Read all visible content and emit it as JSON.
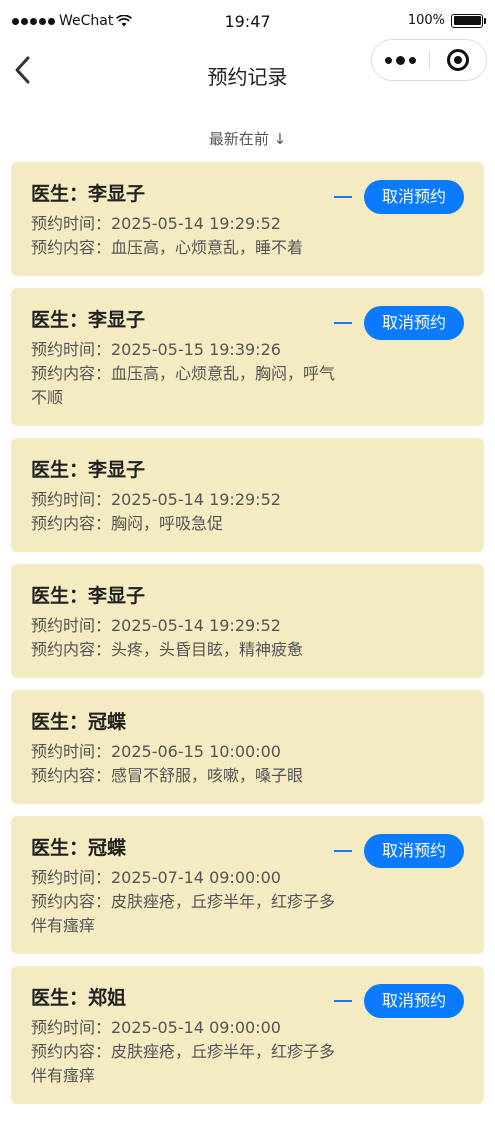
{
  "status_bar": {
    "carrier": "WeChat",
    "time": "19:47",
    "battery": "100%"
  },
  "nav": {
    "title": "预约记录"
  },
  "sort_label": "最新在前 ↓",
  "cancel_label": "取消预约",
  "records": [
    {
      "doctor": "医生：李显子",
      "time": "预约时间：2025-05-14 19:29:52",
      "content": "预约内容：血压高，心烦意乱，睡不着",
      "cancellable": true
    },
    {
      "doctor": "医生：李显子",
      "time": "预约时间：2025-05-15 19:39:26",
      "content": "预约内容：血压高，心烦意乱，胸闷，呼气不顺",
      "cancellable": true
    },
    {
      "doctor": "医生：李显子",
      "time": "预约时间：2025-05-14 19:29:52",
      "content": "预约内容：胸闷，呼吸急促",
      "cancellable": false
    },
    {
      "doctor": "医生：李显子",
      "time": "预约时间：2025-05-14 19:29:52",
      "content": "预约内容：头疼，头昏目眩，精神疲惫",
      "cancellable": false
    },
    {
      "doctor": "医生：冠蝶",
      "time": "预约时间：2025-06-15 10:00:00",
      "content": "预约内容：感冒不舒服，咳嗽，嗓子眼",
      "cancellable": false
    },
    {
      "doctor": "医生：冠蝶",
      "time": "预约时间：2025-07-14 09:00:00",
      "content": "预约内容：皮肤痤疮，丘疹半年，红疹子多伴有瘙痒",
      "cancellable": true
    },
    {
      "doctor": "医生：郑姐",
      "time": "预约时间：2025-05-14 09:00:00",
      "content": "预约内容：皮肤痤疮，丘疹半年，红疹子多伴有瘙痒",
      "cancellable": true
    }
  ]
}
